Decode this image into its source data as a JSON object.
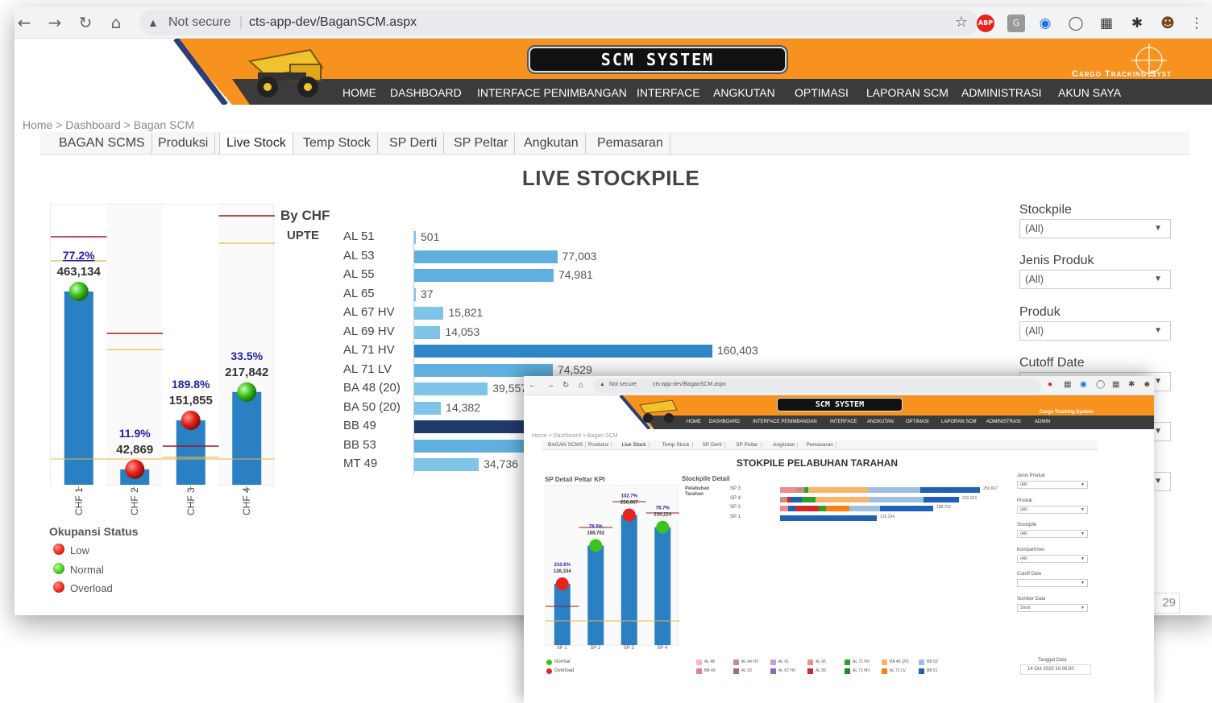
{
  "browser": {
    "security": "Not secure",
    "url": "cts-app-dev/BaganSCM.aspx"
  },
  "header": {
    "system_title": "SCM SYSTEM",
    "tagline": "Cargo Tracking Syst",
    "menu": [
      "HOME",
      "DASHBOARD",
      "INTERFACE PENIMBANGAN",
      "INTERFACE",
      "ANGKUTAN",
      "OPTIMASI",
      "LAPORAN SCM",
      "ADMINISTRASI",
      "AKUN SAYA"
    ]
  },
  "breadcrumb": "Home > Dashboard > Bagan SCM",
  "tabs": [
    "BAGAN SCMS",
    "Produksi",
    "Live Stock",
    "Temp Stock",
    "SP Derti",
    "SP Peltar",
    "Angkutan",
    "Pemasaran"
  ],
  "active_tab": "Live Stock",
  "page_title": "LIVE STOCKPILE",
  "filters": [
    {
      "label": "Stockpile",
      "value": "(All)"
    },
    {
      "label": "Jenis Produk",
      "value": "(All)"
    },
    {
      "label": "Produk",
      "value": "(All)"
    },
    {
      "label": "Cutoff Date",
      "value": ""
    }
  ],
  "partial_page_number": "29",
  "chf_chart": {
    "bars": [
      {
        "name": "CHF 1",
        "pct": "77.2%",
        "value": "463,134",
        "status": "Normal",
        "fill_fraction": 0.75
      },
      {
        "name": "CHF 2",
        "pct": "11.9%",
        "value": "42,869",
        "status": "Overload",
        "fill_fraction": 0.06
      },
      {
        "name": "CHF 3",
        "pct": "189.8%",
        "value": "151,855",
        "status": "Overload",
        "fill_fraction": 0.25
      },
      {
        "name": "CHF 4",
        "pct": "33.5%",
        "value": "217,842",
        "status": "Normal",
        "fill_fraction": 0.36
      }
    ]
  },
  "legend": {
    "title": "Okupansi Status",
    "items": [
      {
        "label": "Low",
        "color": "#e8231d"
      },
      {
        "label": "Normal",
        "color": "#3cc41e"
      },
      {
        "label": "Overload",
        "color": "#e8231d"
      }
    ]
  },
  "chart_data": {
    "type": "bar",
    "title": "By CHF",
    "group_label": "UPTE",
    "categories": [
      "AL 51",
      "AL 53",
      "AL 55",
      "AL 65",
      "AL 67 HV",
      "AL 69 HV",
      "AL 71 HV",
      "AL 71 LV",
      "BA 48 (20)",
      "BA 50 (20)",
      "BB 49",
      "BB 53",
      "MT 49"
    ],
    "values": [
      501,
      77003,
      74981,
      37,
      15821,
      14053,
      160403,
      74529,
      39557,
      null,
      null,
      null,
      34736
    ],
    "value_labels": [
      "501",
      "77,003",
      "74,981",
      "37",
      "15,821",
      "14,053",
      "160,403",
      "74,529",
      "39,557",
      "14,382",
      "",
      "",
      "34,736"
    ],
    "colors": [
      "#7ec3e8",
      "#5fb0df",
      "#5fb0df",
      "#7ec3e8",
      "#7ec3e8",
      "#7ec3e8",
      "#2f86c6",
      "#5fb0df",
      "#7ec3e8",
      "#7ec3e8",
      "#213a6e",
      "#5fb0df",
      "#7ec3e8"
    ]
  },
  "overlay": {
    "security": "Not secure",
    "url": "cts-app-dev/BaganSCM.aspx",
    "system_title": "SCM SYSTEM",
    "tagline": "Cargo Tracking System",
    "menu": [
      "HOME",
      "DASHBOARD",
      "INTERFACE PENIMBANGAN",
      "INTERFACE",
      "ANGKUTAN",
      "OPTIMASI",
      "LAPORAN SCM",
      "ADMINISTRASI",
      "ADMIN"
    ],
    "breadcrumb": "Home > Dashboard > Bagan SCM",
    "tabs": [
      "BAGAN SCMS",
      "Produksi",
      "Live Stock",
      "Temp Stock",
      "SP Derti",
      "SP Peltar",
      "Angkutan",
      "Pemasaran"
    ],
    "page_title": "STOKPILE PELABUHAN TARAHAN",
    "kpi_title": "SP Detail Peltar KPI",
    "kpi_bars": [
      {
        "name": "SP 1",
        "pct": "210.6%",
        "value": "126,334",
        "status": "Overload",
        "fill_fraction": 0.4
      },
      {
        "name": "SP 2",
        "pct": "78.5%",
        "value": "188,702",
        "status": "Normal",
        "fill_fraction": 0.65
      },
      {
        "name": "SP 3",
        "pct": "102.7%",
        "value": "256,667",
        "status": "Overload",
        "fill_fraction": 0.85
      },
      {
        "name": "SP 4",
        "pct": "76.7%",
        "value": "230,224",
        "status": "Normal",
        "fill_fraction": 0.77
      }
    ],
    "detail_title": "Stockpile Detail",
    "detail_group": "Pelabuhan Tarahan",
    "detail_rows": [
      {
        "name": "SP 3",
        "total": "256,667"
      },
      {
        "name": "SP 4",
        "total": "230,224"
      },
      {
        "name": "SP 2",
        "total": "188,702"
      },
      {
        "name": "SP 1",
        "total": "126,334"
      }
    ],
    "filters": [
      {
        "label": "Jenis Produk",
        "value": "(All)"
      },
      {
        "label": "Produk",
        "value": "(All)"
      },
      {
        "label": "Stockpile",
        "value": "(All)"
      },
      {
        "label": "Kompartmen",
        "value": "(All)"
      },
      {
        "label": "Cutoff Date",
        "value": ""
      },
      {
        "label": "Sumber Data",
        "value": "Stock"
      }
    ],
    "legend_status": [
      "Normal",
      "Overload"
    ],
    "product_legend": [
      {
        "label": "AL 48",
        "color": "#f3b7d0"
      },
      {
        "label": "AL 64 HV",
        "color": "#c58d8d"
      },
      {
        "label": "AL 61",
        "color": "#c6a0d6"
      },
      {
        "label": "AL 65",
        "color": "#f08c8c"
      },
      {
        "label": "AL 71 HV",
        "color": "#2ca02c"
      },
      {
        "label": "BA 48 (20)",
        "color": "#f7b46a"
      },
      {
        "label": "BB 53",
        "color": "#9bbfe0"
      },
      {
        "label": "BB 49",
        "color": "#e07bb5"
      },
      {
        "label": "AL 53",
        "color": "#b5695a"
      },
      {
        "label": "AL 67 HV",
        "color": "#9467bd"
      },
      {
        "label": "AL 55",
        "color": "#d62728"
      },
      {
        "label": "AL 71 MV",
        "color": "#1f8a1f"
      },
      {
        "label": "AL 71 LV",
        "color": "#ff7f0e"
      },
      {
        "label": "BB 51",
        "color": "#1f5fb4"
      }
    ],
    "date_label": "Tanggal Data",
    "date_value": "14 Oct 2020 10:00:50"
  }
}
